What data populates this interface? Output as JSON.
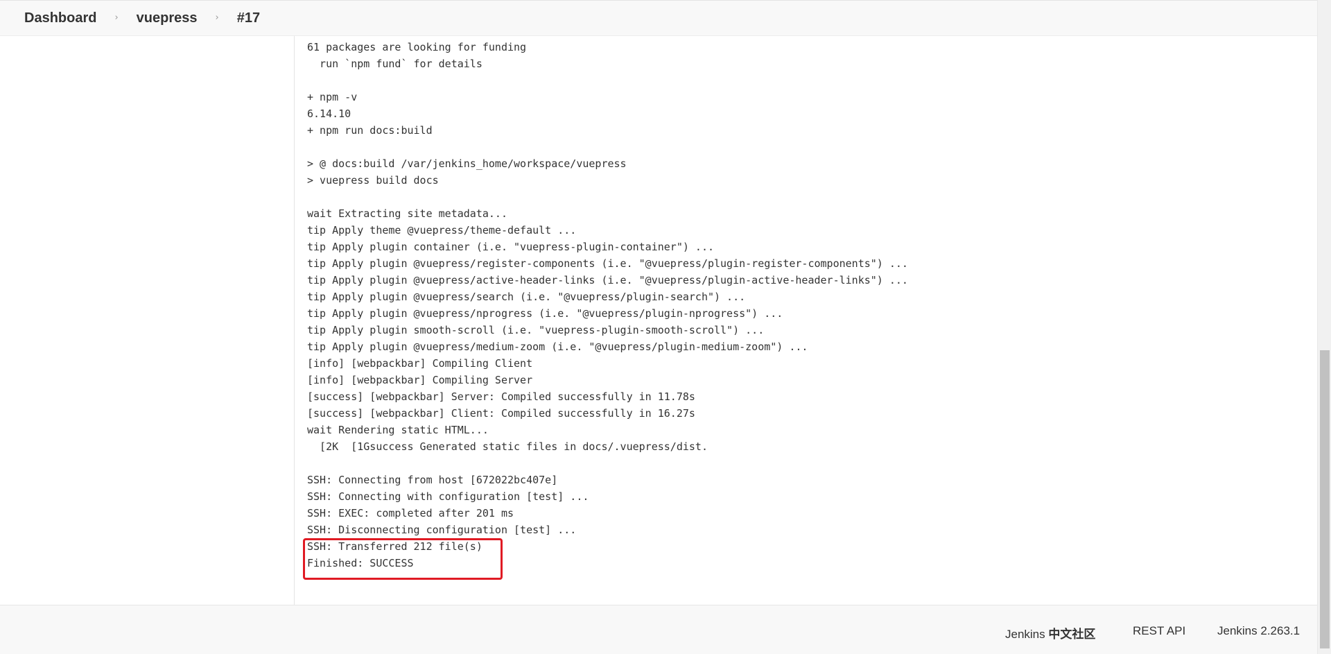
{
  "breadcrumb": {
    "items": [
      {
        "label": "Dashboard"
      },
      {
        "label": "vuepress"
      },
      {
        "label": "#17"
      }
    ],
    "separator": "›"
  },
  "console": {
    "lines": [
      "61 packages are looking for funding",
      "  run `npm fund` for details",
      "",
      "+ npm -v",
      "6.14.10",
      "+ npm run docs:build",
      "",
      "> @ docs:build /var/jenkins_home/workspace/vuepress",
      "> vuepress build docs",
      "",
      "wait Extracting site metadata...",
      "tip Apply theme @vuepress/theme-default ...",
      "tip Apply plugin container (i.e. \"vuepress-plugin-container\") ...",
      "tip Apply plugin @vuepress/register-components (i.e. \"@vuepress/plugin-register-components\") ...",
      "tip Apply plugin @vuepress/active-header-links (i.e. \"@vuepress/plugin-active-header-links\") ...",
      "tip Apply plugin @vuepress/search (i.e. \"@vuepress/plugin-search\") ...",
      "tip Apply plugin @vuepress/nprogress (i.e. \"@vuepress/plugin-nprogress\") ...",
      "tip Apply plugin smooth-scroll (i.e. \"vuepress-plugin-smooth-scroll\") ...",
      "tip Apply plugin @vuepress/medium-zoom (i.e. \"@vuepress/plugin-medium-zoom\") ...",
      "[info] [webpackbar] Compiling Client",
      "[info] [webpackbar] Compiling Server",
      "[success] [webpackbar] Server: Compiled successfully in 11.78s",
      "[success] [webpackbar] Client: Compiled successfully in 16.27s",
      "wait Rendering static HTML...",
      "  [2K  [1Gsuccess Generated static files in docs/.vuepress/dist.",
      "",
      "SSH: Connecting from host [672022bc407e]",
      "SSH: Connecting with configuration [test] ...",
      "SSH: EXEC: completed after 201 ms",
      "SSH: Disconnecting configuration [test] ...",
      "SSH: Transferred 212 file(s)",
      "Finished: SUCCESS"
    ]
  },
  "footer": {
    "community_prefix": "Jenkins ",
    "community_bold": "中文社区",
    "rest_api": "REST API",
    "version": "Jenkins 2.263.1"
  },
  "colors": {
    "highlight": "#e01b24",
    "bar_background": "#f8f8f8",
    "text": "#333333"
  }
}
